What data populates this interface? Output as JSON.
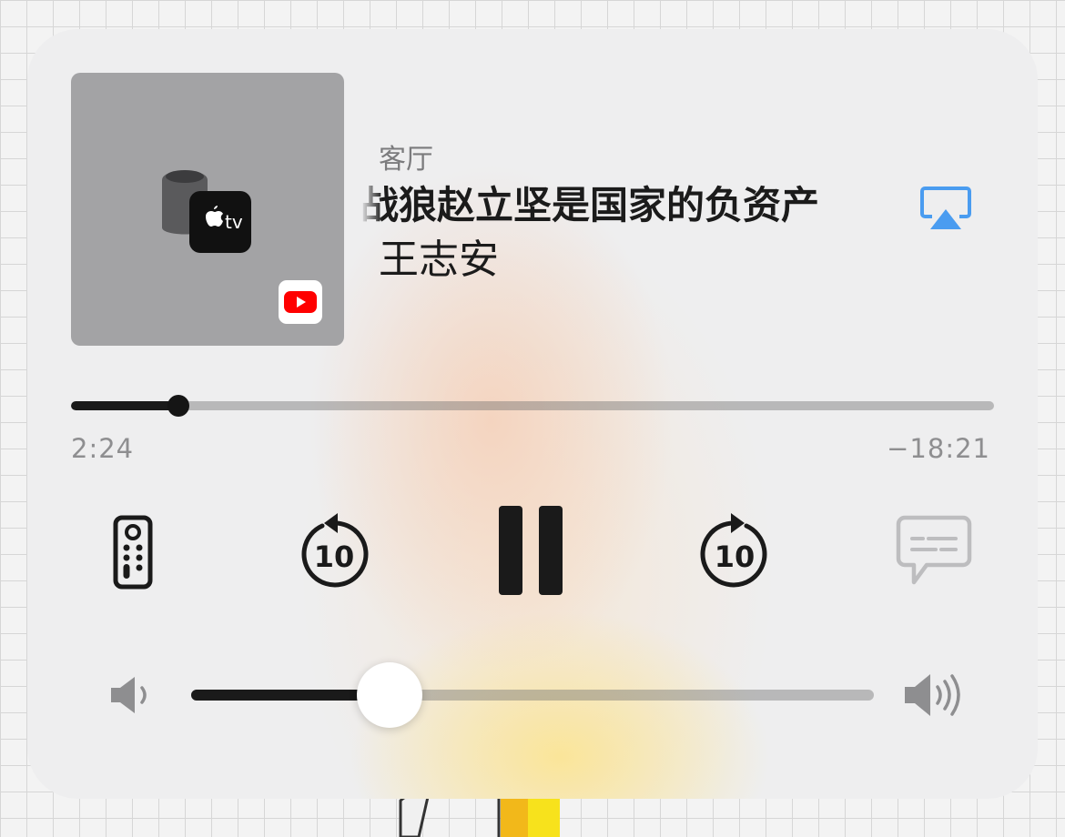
{
  "now_playing": {
    "room": "客厅",
    "title": "战狼赵立坚是国家的负资产",
    "artist": "王志安",
    "app_badge": "youtube-icon",
    "device_icon": "homepod-appletv-icon",
    "device_badge_label": "tv"
  },
  "playback": {
    "elapsed": "2:24",
    "remaining": "−18:21",
    "progress": 0.116,
    "skip_back_label": "10",
    "skip_forward_label": "10",
    "state": "playing"
  },
  "volume": {
    "level": 0.29
  },
  "colors": {
    "accent": "#4a9cf0",
    "youtube_red": "#ff0000"
  },
  "icons": [
    "airplay-icon",
    "remote-icon",
    "skip-back-10-icon",
    "pause-icon",
    "skip-forward-10-icon",
    "captions-icon",
    "volume-low-icon",
    "volume-high-icon"
  ]
}
